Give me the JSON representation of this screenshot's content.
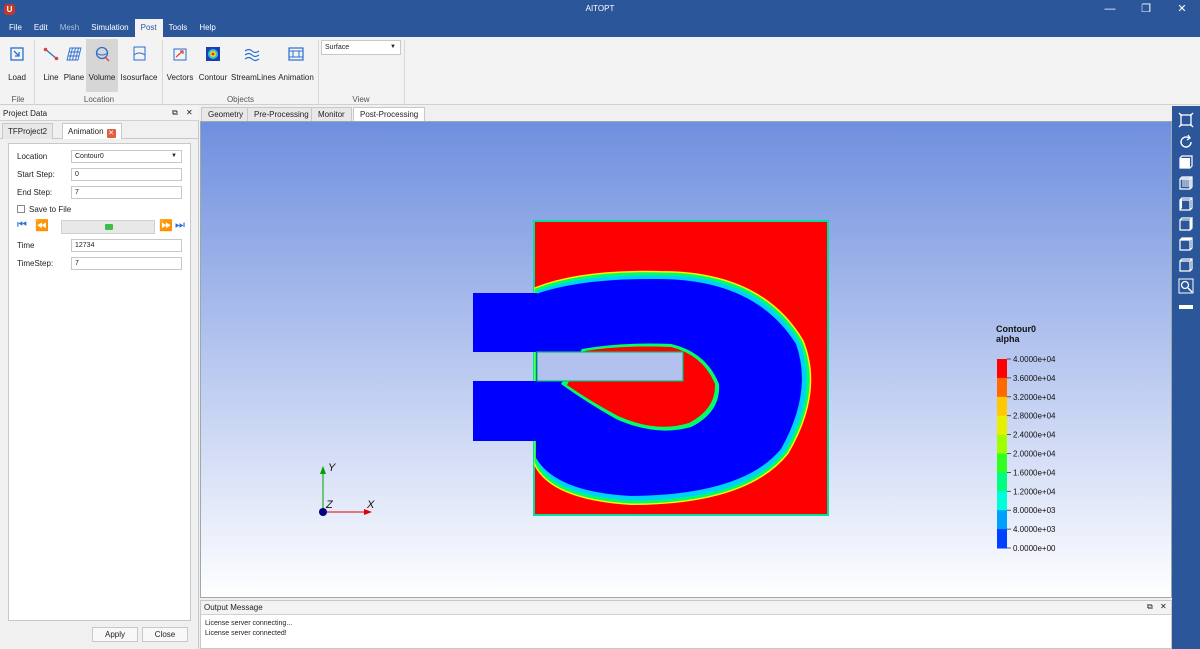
{
  "window": {
    "title": "AITOPT",
    "logo_letter": "U",
    "minimize": "—",
    "restore": "❐",
    "close": "✕"
  },
  "menu": {
    "items": [
      "File",
      "Edit",
      "Mesh",
      "Simulation",
      "Post",
      "Tools",
      "Help"
    ],
    "active": "Post"
  },
  "ribbon": {
    "buttons": {
      "load": "Load",
      "line": "Line",
      "plane": "Plane",
      "volume": "Volume",
      "isosurface": "Isosurface",
      "vectors": "Vectors",
      "contour": "Contour",
      "streamlines": "StreamLines",
      "animation": "Animation"
    },
    "groups": {
      "file": "File",
      "location": "Location",
      "objects": "Objects",
      "view": "View"
    },
    "view_select": "Surface"
  },
  "left_panel": {
    "title": "Project Data",
    "tabs": {
      "project": "TFProject2",
      "animation": "Animation"
    },
    "fields": {
      "location_label": "Location",
      "location_value": "Contour0",
      "start_label": "Start Step:",
      "start_value": "0",
      "end_label": "End Step:",
      "end_value": "7",
      "save_label": "Save to File",
      "time_label": "Time",
      "time_value": "12734",
      "timestep_label": "TimeStep:",
      "timestep_value": "7"
    },
    "apply": "Apply",
    "close": "Close"
  },
  "view_tabs": [
    "Geometry",
    "Pre-Processing",
    "Monitor",
    "Post-Processing"
  ],
  "active_view_tab": "Post-Processing",
  "legend": {
    "name": "Contour0",
    "variable": "alpha",
    "labels": [
      "4.0000e+04",
      "3.6000e+04",
      "3.2000e+04",
      "2.8000e+04",
      "2.4000e+04",
      "2.0000e+04",
      "1.6000e+04",
      "1.2000e+04",
      "8.0000e+03",
      "4.0000e+03",
      "0.0000e+00"
    ]
  },
  "axes": {
    "x": "X",
    "y": "Y",
    "z": "Z"
  },
  "output": {
    "title": "Output Message",
    "lines": [
      "License server connecting...",
      "License server connected!"
    ]
  },
  "colors": {
    "accent": "#2b579a",
    "hot": "#ff0000",
    "cold": "#0000ff",
    "mid": "#00ff66"
  }
}
